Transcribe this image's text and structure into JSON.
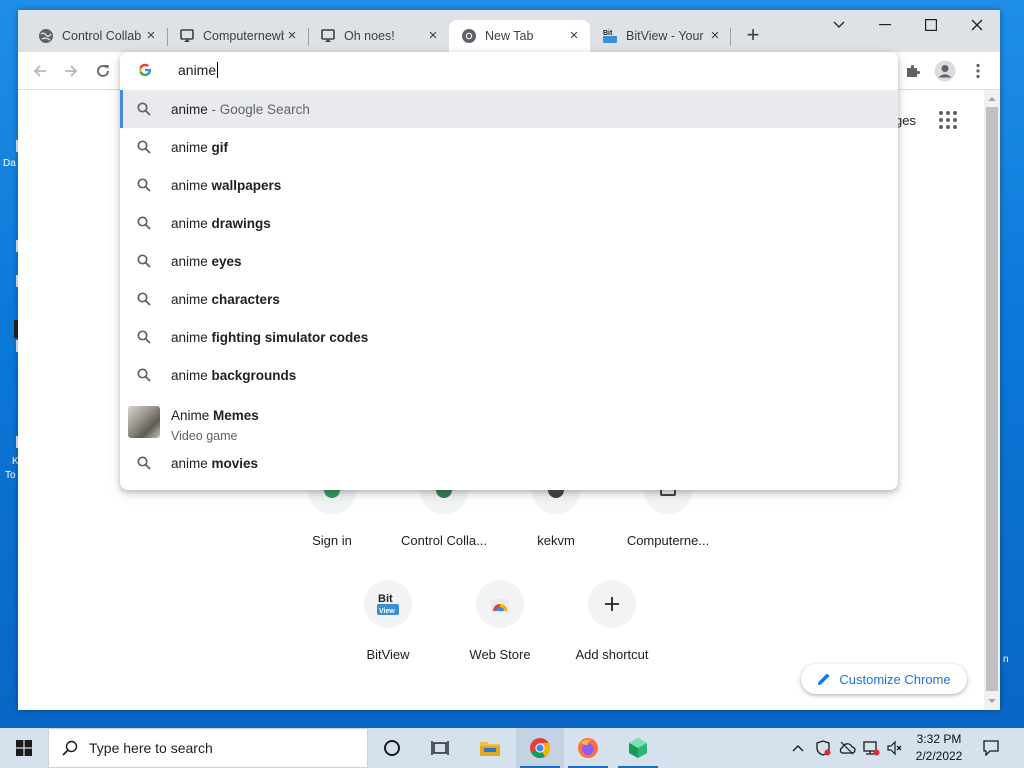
{
  "desktop": {
    "fragments": [
      "Da",
      "K",
      "To"
    ]
  },
  "tabs": [
    {
      "title": "Control Collab",
      "icon": "globe-icon"
    },
    {
      "title": "Computernewb",
      "icon": "computernewb-icon"
    },
    {
      "title": "Oh noes!",
      "icon": "computernewb-icon"
    },
    {
      "title": "New Tab",
      "icon": "chrome-icon",
      "active": true
    },
    {
      "title": "BitView - Your",
      "icon": "bitview-icon"
    }
  ],
  "omnibox": {
    "query": "anime",
    "suggestions": [
      {
        "prefix": "anime",
        "bold": "",
        "suffix": " - Google Search",
        "selected": true
      },
      {
        "prefix": "anime ",
        "bold": "gif"
      },
      {
        "prefix": "anime ",
        "bold": "wallpapers"
      },
      {
        "prefix": "anime ",
        "bold": "drawings"
      },
      {
        "prefix": "anime ",
        "bold": "eyes"
      },
      {
        "prefix": "anime ",
        "bold": "characters"
      },
      {
        "prefix": "anime ",
        "bold": "fighting simulator codes"
      },
      {
        "prefix": "anime ",
        "bold": "backgrounds"
      }
    ],
    "entity": {
      "prefix": "Anime ",
      "bold": "Memes",
      "subtitle": "Video game"
    },
    "last": {
      "prefix": "anime ",
      "bold": "movies"
    }
  },
  "newtab": {
    "images_link_partial": "ges",
    "shortcuts_row1": [
      "Sign in",
      "Control Colla...",
      "kekvm",
      "Computerne..."
    ],
    "shortcuts_row2": [
      "BitView",
      "Web Store",
      "Add shortcut"
    ],
    "customize_label": "Customize Chrome"
  },
  "taskbar": {
    "search_placeholder": "Type here to search",
    "time": "3:32 PM",
    "date": "2/2/2022"
  },
  "colors": {
    "accent": "#1a73e8",
    "selected_bar": "#4a86e8",
    "tabstrip": "#dee1e6"
  }
}
